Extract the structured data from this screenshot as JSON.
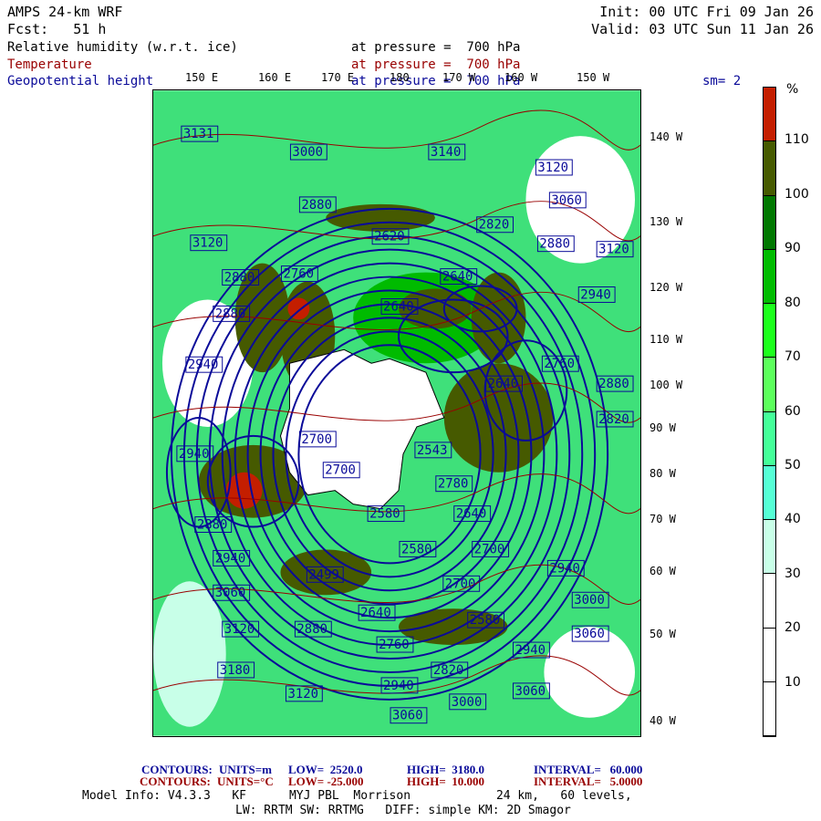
{
  "header": {
    "model": "AMPS 24-km WRF",
    "forecast": "Fcst:   51 h",
    "init": "Init: 00 UTC Fri 09 Jan 26",
    "valid": "Valid: 03 UTC Sun 11 Jan 26",
    "fields": [
      {
        "name": "Relative humidity (w.r.t. ice)",
        "level": "at pressure =  700 hPa",
        "color": "#000000"
      },
      {
        "name": "Temperature",
        "level": "at pressure =  700 hPa",
        "color": "#990000"
      },
      {
        "name": "Geopotential height",
        "level": "at pressure =  700 hPa",
        "color": "#0a0a99"
      }
    ],
    "smoothing": "sm= 2"
  },
  "map": {
    "lon_labels": [
      "150 E",
      "160 E",
      "170 E",
      "180",
      "170 W",
      "160 W",
      "150 W"
    ],
    "lat_labels": [
      "140 W",
      "130 W",
      "120 W",
      "110 W",
      "100 W",
      "90 W",
      "80 W",
      "70 W",
      "60 W",
      "50 W",
      "40 W"
    ],
    "contour_labels": [
      "3131",
      "3000",
      "3140",
      "3120",
      "2880",
      "3060",
      "2620",
      "2820",
      "3120",
      "2880",
      "3120",
      "2760",
      "2880",
      "2640",
      "2940",
      "2880",
      "2640",
      "2940",
      "2760",
      "2880",
      "2640",
      "2820",
      "2700",
      "2700",
      "2543",
      "2580",
      "2780",
      "2640",
      "2940",
      "2880",
      "2940",
      "2580",
      "2700",
      "2940",
      "3060",
      "2700",
      "3000",
      "2640",
      "2580",
      "3120",
      "2880",
      "3060",
      "2760",
      "2940",
      "3180",
      "2820",
      "2940",
      "3000",
      "3060",
      "3120",
      "3060",
      "2499"
    ]
  },
  "colorbar": {
    "unit": "%",
    "ticks": [
      "110",
      "100",
      "90",
      "80",
      "70",
      "60",
      "50",
      "40",
      "30",
      "20",
      "10"
    ],
    "colors": [
      "#c41e00",
      "#465a00",
      "#007700",
      "#00bb00",
      "#1cff1c",
      "#5cff5c",
      "#44ff99",
      "#55ffd5",
      "#c8ffe8",
      "#ffffff",
      "#ffffff",
      "#ffffff"
    ]
  },
  "footer": {
    "height_contours": {
      "label": "CONTOURS:",
      "units": "UNITS=m",
      "low": "LOW=  2520.0",
      "high": "HIGH=  3180.0",
      "interval": "INTERVAL=   60.000"
    },
    "temp_contours": {
      "label": "CONTOURS:",
      "units": "UNITS=°C",
      "low": "LOW= -25.000",
      "high": "HIGH=  10.000",
      "interval": "INTERVAL=   5.0000"
    },
    "model_info": "Model Info: V4.3.3   KF      MYJ PBL  Morrison            24 km,   60 levels,",
    "model_info2": "LW: RRTM SW: RRTMG   DIFF: simple KM: 2D Smagor"
  }
}
